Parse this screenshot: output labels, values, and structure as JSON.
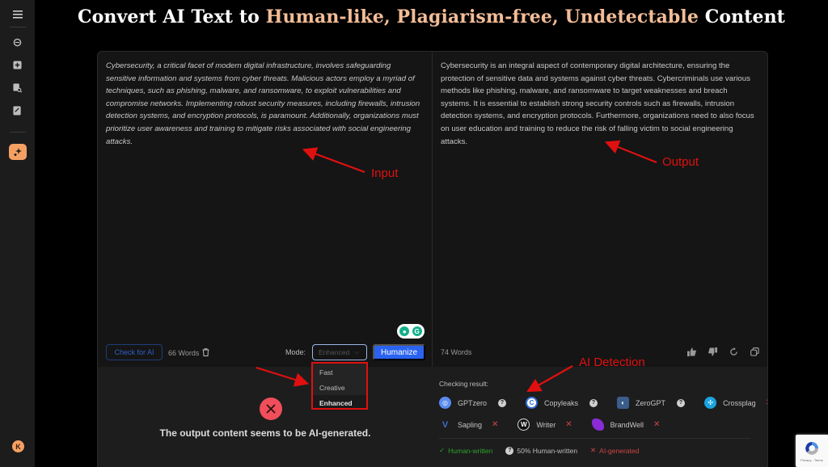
{
  "title": {
    "part1": "Convert AI Text to ",
    "highlight": "Human-like, Plagiarism-free, Undetectable",
    "part2": " Content"
  },
  "sidebar": {
    "items": [
      {
        "icon": "menu-icon"
      },
      {
        "icon": "refresh-icon"
      },
      {
        "icon": "add-icon"
      },
      {
        "icon": "document-search-icon"
      },
      {
        "icon": "document-edit-icon"
      },
      {
        "icon": "ai-humanizer-icon",
        "active": true
      }
    ],
    "avatar_initial": "K",
    "accent_color": "#f5a063"
  },
  "input": {
    "text": "Cybersecurity, a critical facet of modern digital infrastructure, involves safeguarding sensitive information and systems from cyber threats. Malicious actors employ a myriad of techniques, such as phishing, malware, and ransomware, to exploit vulnerabilities and compromise networks. Implementing robust security measures, including firewalls, intrusion detection systems, and encryption protocols, is paramount. Additionally, organizations must prioritize user awareness and training to mitigate risks associated with social engineering attacks.",
    "word_count": "66 Words",
    "check_button": "Check for AI",
    "mode_label": "Mode:",
    "mode_value": "Enhanced",
    "humanize_button": "Humanize"
  },
  "mode_options": [
    {
      "label": "Fast"
    },
    {
      "label": "Creative"
    },
    {
      "label": "Enhanced",
      "selected": true
    }
  ],
  "output": {
    "text": "Cybersecurity is an integral aspect of contemporary digital architecture, ensuring the protection of sensitive data and systems against cyber threats. Cybercriminals use various methods like phishing, malware, and ransomware to target weaknesses and breach systems. It is essential to establish strong security controls such as firewalls, intrusion detection systems, and encryption protocols. Furthermore, organizations need to also focus on user education and training to reduce the risk of falling victim to social engineering attacks.",
    "word_count": "74 Words"
  },
  "result": {
    "message": "The output content seems to be AI-generated.",
    "checking_label": "Checking result:",
    "detectors_row1": [
      {
        "name": "GPTzero",
        "status": "unknown",
        "color": "#5b8cf0"
      },
      {
        "name": "Copyleaks",
        "status": "unknown",
        "color": "#2f6fd8"
      },
      {
        "name": "ZeroGPT",
        "status": "unknown",
        "color": "#3a5d8c"
      },
      {
        "name": "Crossplag",
        "status": "ai",
        "color": "#1aa3e0"
      }
    ],
    "detectors_row2": [
      {
        "name": "Sapling",
        "status": "ai",
        "color": "#3b6fc9"
      },
      {
        "name": "Writer",
        "status": "ai",
        "color": "#222222"
      },
      {
        "name": "BrandWell",
        "status": "ai",
        "color": "#8a2bd8"
      }
    ],
    "legend": {
      "human": "Human-written",
      "half": "50% Human-written",
      "ai": "AI-generated"
    },
    "colors": {
      "human": "#2aa52a",
      "ai": "#d14545",
      "fail": "#f04e5a"
    }
  },
  "annotations": {
    "input": "Input",
    "output": "Output",
    "ai_detection": "AI Detection"
  },
  "recaptcha": {
    "text": "Privacy - Terms"
  }
}
